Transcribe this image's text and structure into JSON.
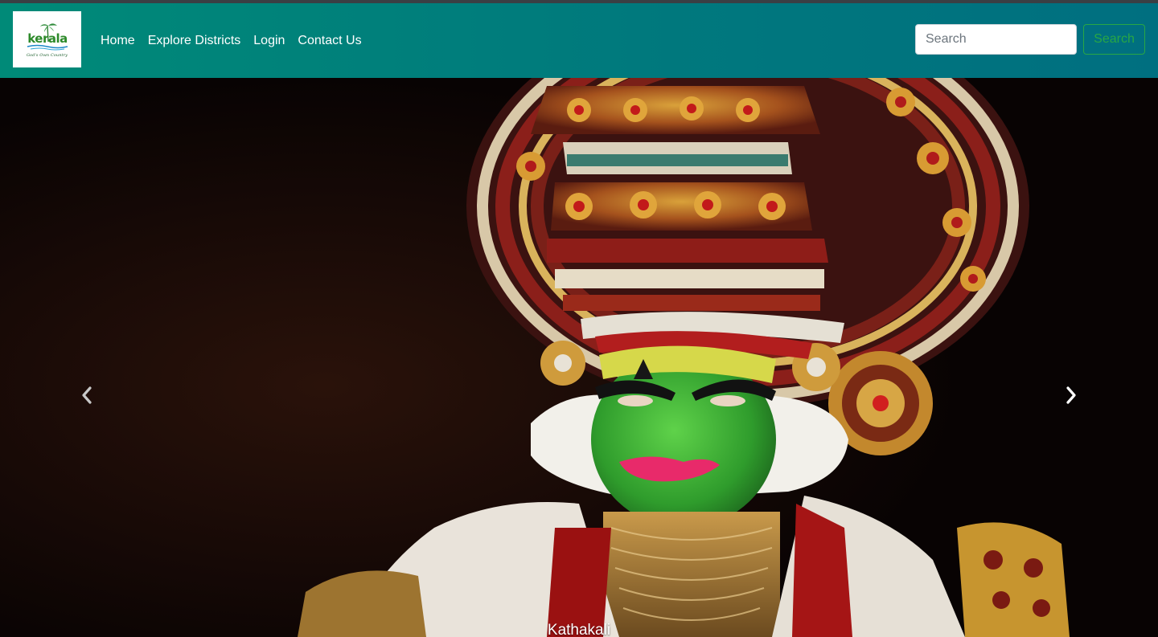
{
  "navbar": {
    "logo": {
      "text": "kerala",
      "tagline": "God's Own Country"
    },
    "links": [
      {
        "label": "Home"
      },
      {
        "label": "Explore Districts"
      },
      {
        "label": "Login"
      },
      {
        "label": "Contact Us"
      }
    ],
    "search": {
      "placeholder": "Search",
      "button_label": "Search"
    }
  },
  "carousel": {
    "caption": "Kathakali",
    "prev_icon": "chevron-left-icon",
    "next_icon": "chevron-right-icon"
  },
  "colors": {
    "navbar": "#007a7b",
    "search_button": "#28a745"
  }
}
